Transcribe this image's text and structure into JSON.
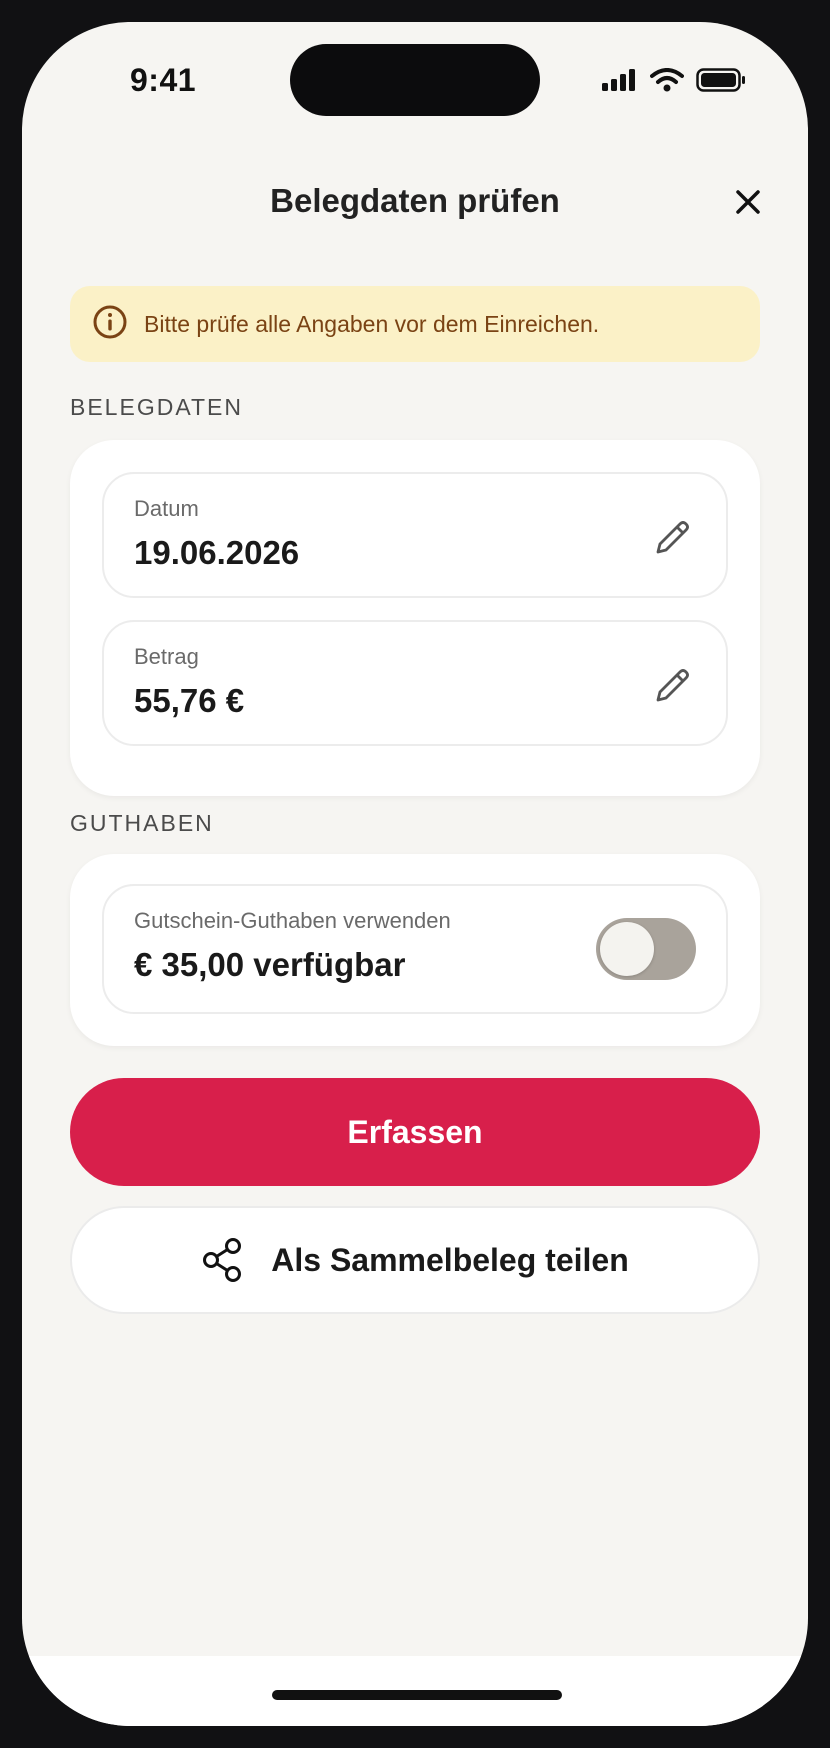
{
  "status_bar": {
    "time": "9:41"
  },
  "header": {
    "title": "Belegdaten prüfen",
    "close_icon": "close-icon"
  },
  "notice": {
    "text": "Bitte prüfe alle Angaben vor dem Einreichen.",
    "icon": "info-icon",
    "bg": "#fbf1c7",
    "color": "#7a4314"
  },
  "belegdaten": {
    "section_label": "BELEGDATEN",
    "fields": [
      {
        "label": "Datum",
        "value": "19.06.2026",
        "icon": "pencil-icon"
      },
      {
        "label": "Betrag",
        "value": "55,76 €",
        "icon": "pencil-icon"
      }
    ]
  },
  "guthaben": {
    "section_label": "GUTHABEN",
    "label": "Gutschein-Guthaben verwenden",
    "value": "€ 35,00 verfügbar",
    "toggle_on": false
  },
  "actions": {
    "primary_label": "Erfassen",
    "primary_color": "#d81f4b",
    "secondary_label": "Als Sammelbeleg teilen",
    "secondary_icon": "share-icon"
  }
}
